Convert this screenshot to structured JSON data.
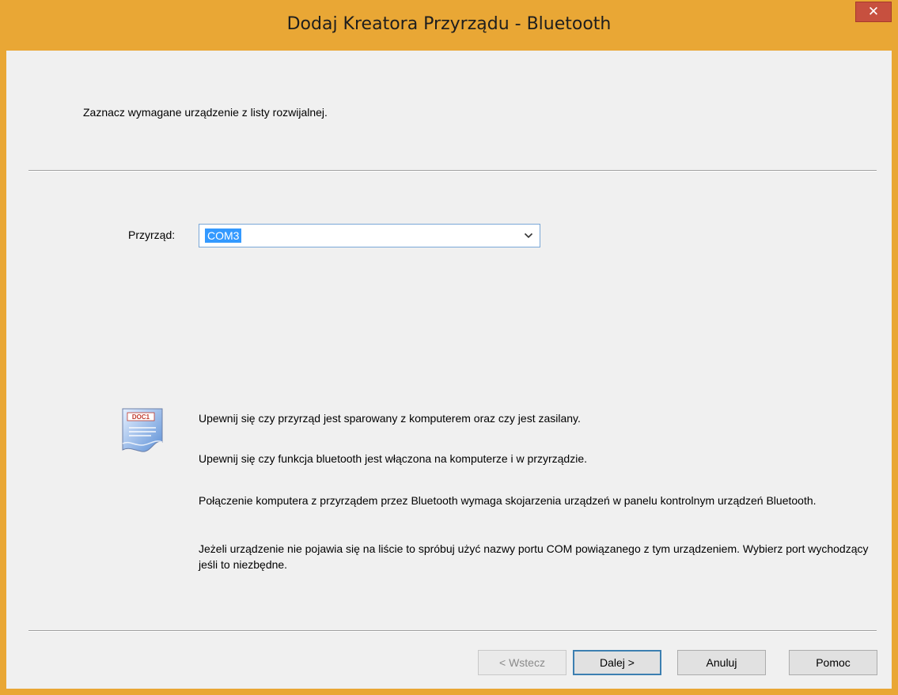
{
  "window": {
    "title": "Dodaj Kreatora Przyrządu - Bluetooth",
    "close_glyph": "✕"
  },
  "header": {
    "instruction": "Zaznacz wymagane urządzenie z listy rozwijalnej."
  },
  "device": {
    "label": "Przyrząd:",
    "selected": "COM3"
  },
  "icon": {
    "name": "document-icon",
    "caption": "DOC1"
  },
  "info": {
    "line1": "Upewnij się czy przyrząd jest sparowany z komputerem oraz czy jest zasilany.",
    "line2": "Upewnij się czy funkcja bluetooth jest włączona na komputerze i w przyrządzie.",
    "line3": "Połączenie komputera z przyrządem przez Bluetooth wymaga skojarzenia urządzeń w panelu kontrolnym urządzeń Bluetooth.",
    "line4": "Jeżeli urządzenie nie pojawia się na liście to spróbuj użyć nazwy portu COM powiązanego z tym urządzeniem. Wybierz port wychodzący jeśli to niezbędne."
  },
  "buttons": {
    "back": "< Wstecz",
    "next": "Dalej >",
    "cancel": "Anuluj",
    "help": "Pomoc"
  },
  "colors": {
    "titlebar": "#e9a735",
    "close": "#c7503f",
    "selection": "#3399ff",
    "face": "#f0f0f0"
  }
}
